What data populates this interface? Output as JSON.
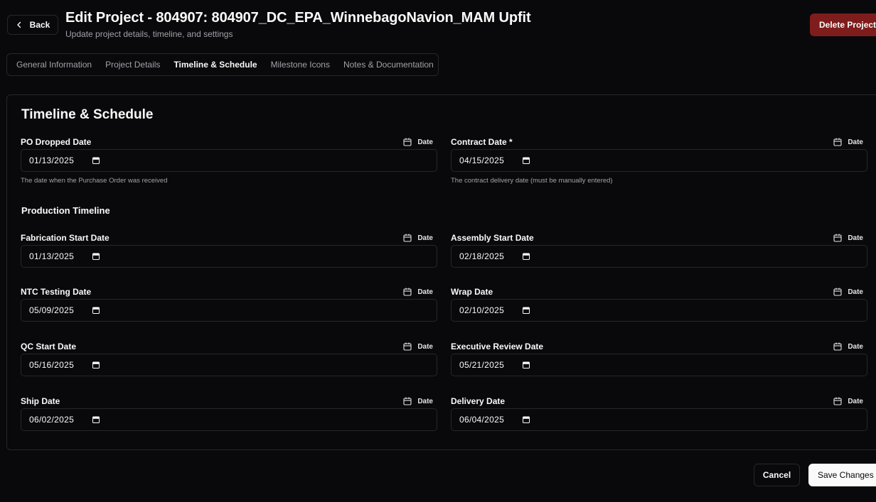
{
  "header": {
    "back_label": "Back",
    "title": "Edit Project - 804907: 804907_DC_EPA_WinnebagoNavion_MAM Upfit",
    "subtitle": "Update project details, timeline, and settings",
    "delete_label": "Delete Project"
  },
  "tabs": [
    {
      "label": "General Information",
      "active": false
    },
    {
      "label": "Project Details",
      "active": false
    },
    {
      "label": "Timeline & Schedule",
      "active": true
    },
    {
      "label": "Milestone Icons",
      "active": false
    },
    {
      "label": "Notes & Documentation",
      "active": false
    }
  ],
  "card": {
    "title": "Timeline & Schedule",
    "production_title": "Production Timeline"
  },
  "fields": {
    "po_dropped": {
      "label": "PO Dropped Date",
      "hint": "Date",
      "value": "01/13/2025",
      "help": "The date when the Purchase Order was received"
    },
    "contract": {
      "label": "Contract Date *",
      "hint": "Date",
      "value": "04/15/2025",
      "help": "The contract delivery date (must be manually entered)"
    },
    "fabrication_start": {
      "label": "Fabrication Start Date",
      "hint": "Date",
      "value": "01/13/2025"
    },
    "assembly_start": {
      "label": "Assembly Start Date",
      "hint": "Date",
      "value": "02/18/2025"
    },
    "ntc_testing": {
      "label": "NTC Testing Date",
      "hint": "Date",
      "value": "05/09/2025"
    },
    "wrap": {
      "label": "Wrap Date",
      "hint": "Date",
      "value": "02/10/2025"
    },
    "qc_start": {
      "label": "QC Start Date",
      "hint": "Date",
      "value": "05/16/2025"
    },
    "executive_review": {
      "label": "Executive Review Date",
      "hint": "Date",
      "value": "05/21/2025"
    },
    "ship": {
      "label": "Ship Date",
      "hint": "Date",
      "value": "06/02/2025"
    },
    "delivery": {
      "label": "Delivery Date",
      "hint": "Date",
      "value": "06/04/2025"
    }
  },
  "footer": {
    "cancel_label": "Cancel",
    "save_label": "Save Changes"
  },
  "colors": {
    "background": "#09090b",
    "border": "#27272a",
    "delete": "#7f1d1d",
    "muted_text": "#a1a1aa"
  }
}
